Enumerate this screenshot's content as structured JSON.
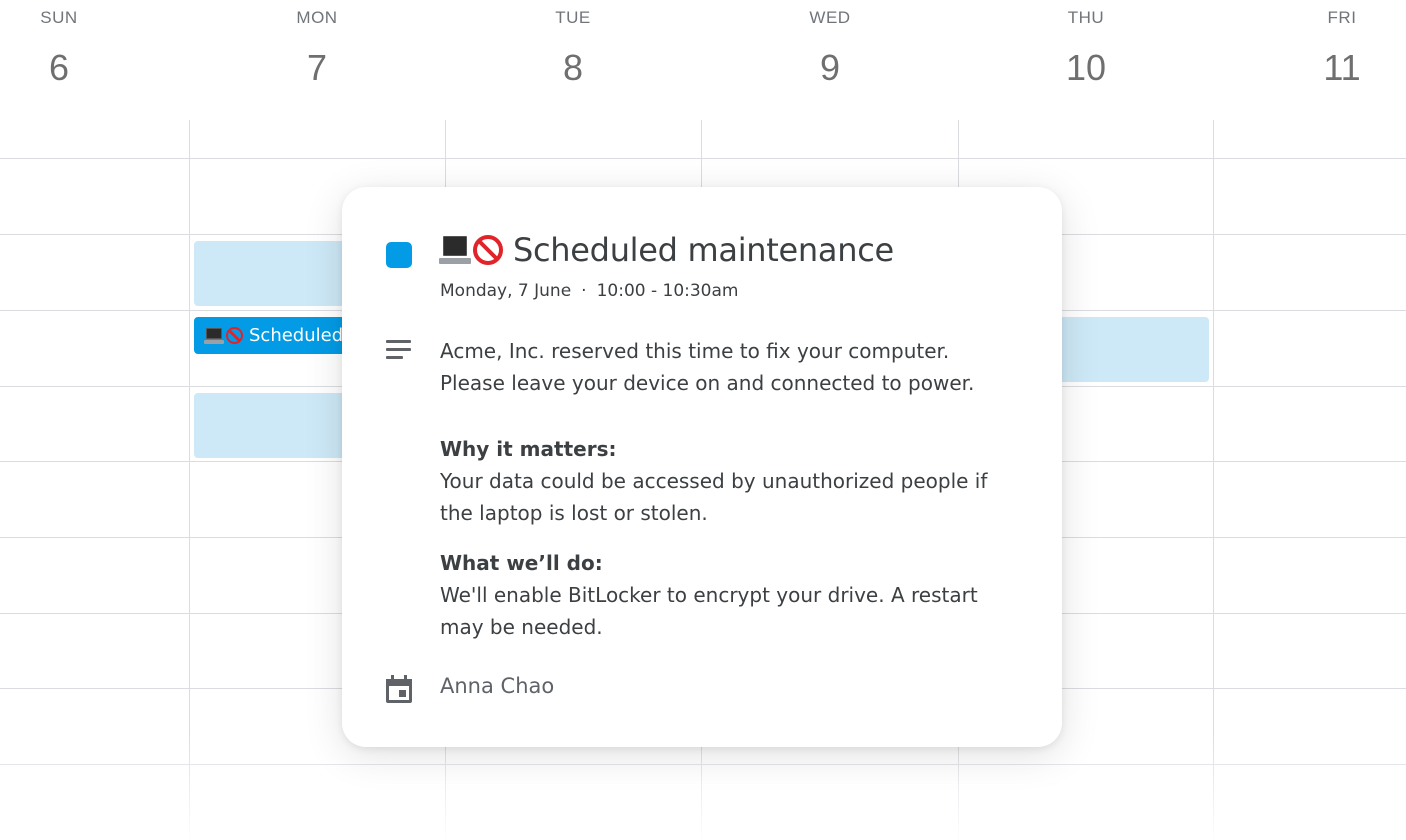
{
  "days": [
    {
      "name": "SUN",
      "date": "6"
    },
    {
      "name": "MON",
      "date": "7"
    },
    {
      "name": "TUE",
      "date": "8"
    },
    {
      "name": "WED",
      "date": "9"
    },
    {
      "name": "THU",
      "date": "10"
    },
    {
      "name": "FRI",
      "date": "11"
    }
  ],
  "calendar_event_chip": {
    "label": "Scheduled",
    "icons": [
      "laptop-icon",
      "prohibited-icon"
    ],
    "color": "#039be5"
  },
  "event_block_color": "#cde8f6",
  "popup": {
    "color": "#039be5",
    "title_icons": [
      "laptop-icon",
      "prohibited-icon"
    ],
    "title": "Scheduled maintenance",
    "date": "Monday, 7 June",
    "separator": "·",
    "time": "10:00 - 10:30am",
    "description": {
      "line1": "Acme, Inc. reserved this time to fix your computer.",
      "line2": "Please leave your device on and connected to power.",
      "why_heading": "Why it matters:",
      "why_body": "Your data could be accessed by unauthorized people if the laptop is lost or stolen.",
      "what_heading": "What we’ll do:",
      "what_body": "We'll enable BitLocker to encrypt your drive. A restart may be needed."
    },
    "organizer": "Anna Chao"
  }
}
